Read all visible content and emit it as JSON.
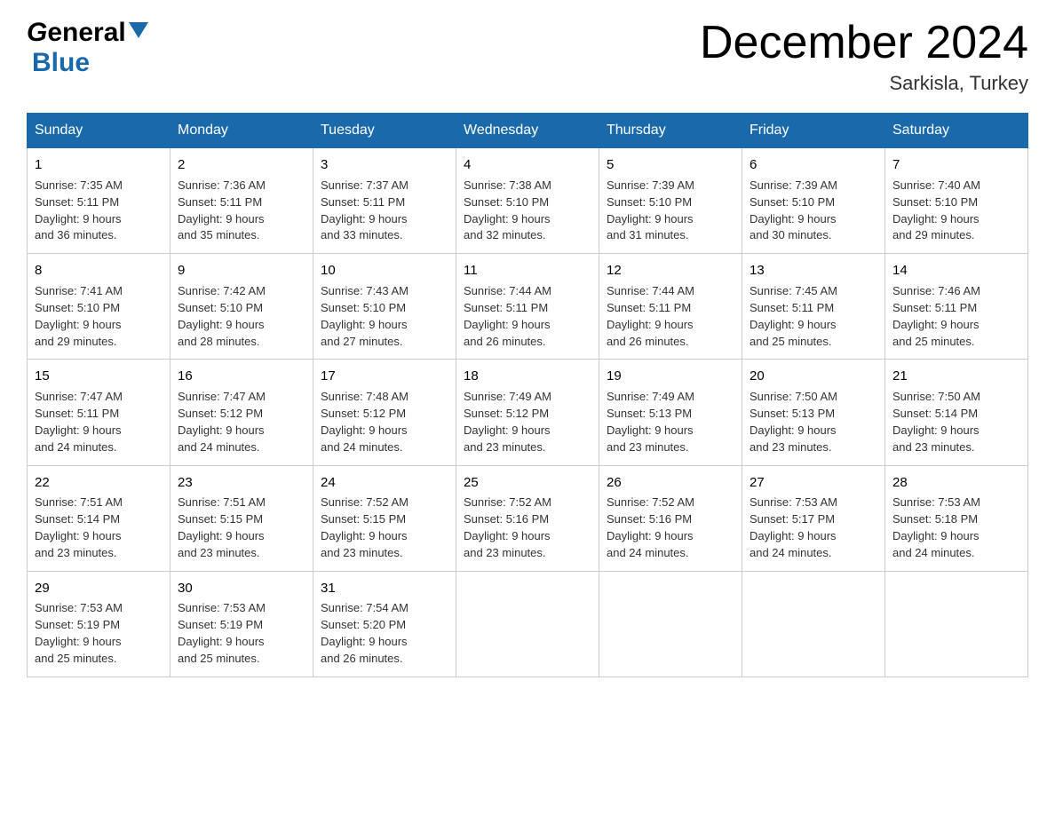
{
  "header": {
    "logo_general": "General",
    "logo_blue": "Blue",
    "month_title": "December 2024",
    "location": "Sarkisla, Turkey"
  },
  "days_of_week": [
    "Sunday",
    "Monday",
    "Tuesday",
    "Wednesday",
    "Thursday",
    "Friday",
    "Saturday"
  ],
  "weeks": [
    [
      {
        "day": "1",
        "sunrise": "7:35 AM",
        "sunset": "5:11 PM",
        "daylight": "9 hours and 36 minutes."
      },
      {
        "day": "2",
        "sunrise": "7:36 AM",
        "sunset": "5:11 PM",
        "daylight": "9 hours and 35 minutes."
      },
      {
        "day": "3",
        "sunrise": "7:37 AM",
        "sunset": "5:11 PM",
        "daylight": "9 hours and 33 minutes."
      },
      {
        "day": "4",
        "sunrise": "7:38 AM",
        "sunset": "5:10 PM",
        "daylight": "9 hours and 32 minutes."
      },
      {
        "day": "5",
        "sunrise": "7:39 AM",
        "sunset": "5:10 PM",
        "daylight": "9 hours and 31 minutes."
      },
      {
        "day": "6",
        "sunrise": "7:39 AM",
        "sunset": "5:10 PM",
        "daylight": "9 hours and 30 minutes."
      },
      {
        "day": "7",
        "sunrise": "7:40 AM",
        "sunset": "5:10 PM",
        "daylight": "9 hours and 29 minutes."
      }
    ],
    [
      {
        "day": "8",
        "sunrise": "7:41 AM",
        "sunset": "5:10 PM",
        "daylight": "9 hours and 29 minutes."
      },
      {
        "day": "9",
        "sunrise": "7:42 AM",
        "sunset": "5:10 PM",
        "daylight": "9 hours and 28 minutes."
      },
      {
        "day": "10",
        "sunrise": "7:43 AM",
        "sunset": "5:10 PM",
        "daylight": "9 hours and 27 minutes."
      },
      {
        "day": "11",
        "sunrise": "7:44 AM",
        "sunset": "5:11 PM",
        "daylight": "9 hours and 26 minutes."
      },
      {
        "day": "12",
        "sunrise": "7:44 AM",
        "sunset": "5:11 PM",
        "daylight": "9 hours and 26 minutes."
      },
      {
        "day": "13",
        "sunrise": "7:45 AM",
        "sunset": "5:11 PM",
        "daylight": "9 hours and 25 minutes."
      },
      {
        "day": "14",
        "sunrise": "7:46 AM",
        "sunset": "5:11 PM",
        "daylight": "9 hours and 25 minutes."
      }
    ],
    [
      {
        "day": "15",
        "sunrise": "7:47 AM",
        "sunset": "5:11 PM",
        "daylight": "9 hours and 24 minutes."
      },
      {
        "day": "16",
        "sunrise": "7:47 AM",
        "sunset": "5:12 PM",
        "daylight": "9 hours and 24 minutes."
      },
      {
        "day": "17",
        "sunrise": "7:48 AM",
        "sunset": "5:12 PM",
        "daylight": "9 hours and 24 minutes."
      },
      {
        "day": "18",
        "sunrise": "7:49 AM",
        "sunset": "5:12 PM",
        "daylight": "9 hours and 23 minutes."
      },
      {
        "day": "19",
        "sunrise": "7:49 AM",
        "sunset": "5:13 PM",
        "daylight": "9 hours and 23 minutes."
      },
      {
        "day": "20",
        "sunrise": "7:50 AM",
        "sunset": "5:13 PM",
        "daylight": "9 hours and 23 minutes."
      },
      {
        "day": "21",
        "sunrise": "7:50 AM",
        "sunset": "5:14 PM",
        "daylight": "9 hours and 23 minutes."
      }
    ],
    [
      {
        "day": "22",
        "sunrise": "7:51 AM",
        "sunset": "5:14 PM",
        "daylight": "9 hours and 23 minutes."
      },
      {
        "day": "23",
        "sunrise": "7:51 AM",
        "sunset": "5:15 PM",
        "daylight": "9 hours and 23 minutes."
      },
      {
        "day": "24",
        "sunrise": "7:52 AM",
        "sunset": "5:15 PM",
        "daylight": "9 hours and 23 minutes."
      },
      {
        "day": "25",
        "sunrise": "7:52 AM",
        "sunset": "5:16 PM",
        "daylight": "9 hours and 23 minutes."
      },
      {
        "day": "26",
        "sunrise": "7:52 AM",
        "sunset": "5:16 PM",
        "daylight": "9 hours and 24 minutes."
      },
      {
        "day": "27",
        "sunrise": "7:53 AM",
        "sunset": "5:17 PM",
        "daylight": "9 hours and 24 minutes."
      },
      {
        "day": "28",
        "sunrise": "7:53 AM",
        "sunset": "5:18 PM",
        "daylight": "9 hours and 24 minutes."
      }
    ],
    [
      {
        "day": "29",
        "sunrise": "7:53 AM",
        "sunset": "5:19 PM",
        "daylight": "9 hours and 25 minutes."
      },
      {
        "day": "30",
        "sunrise": "7:53 AM",
        "sunset": "5:19 PM",
        "daylight": "9 hours and 25 minutes."
      },
      {
        "day": "31",
        "sunrise": "7:54 AM",
        "sunset": "5:20 PM",
        "daylight": "9 hours and 26 minutes."
      },
      null,
      null,
      null,
      null
    ]
  ],
  "labels": {
    "sunrise": "Sunrise:",
    "sunset": "Sunset:",
    "daylight": "Daylight:"
  }
}
